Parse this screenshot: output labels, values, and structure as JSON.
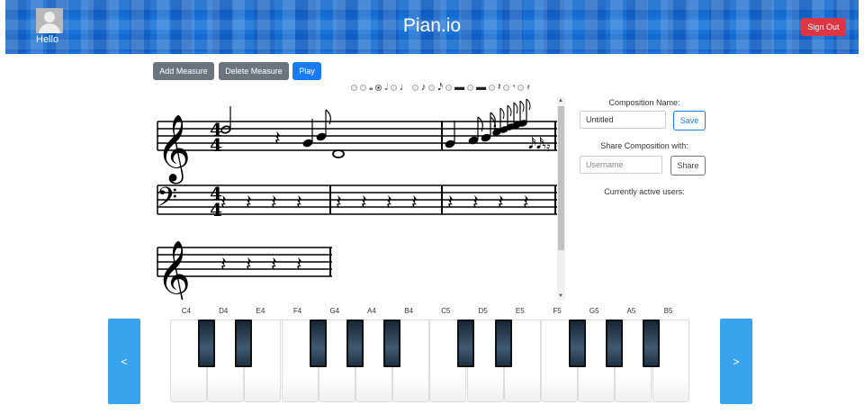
{
  "header": {
    "title": "Pian.io",
    "greeting": "Hello",
    "sign_out": "Sign Out",
    "avatar_icon": "user-avatar-icon"
  },
  "toolbar": {
    "add_measure": "Add Measure",
    "delete_measure": "Delete Measure",
    "play": "Play"
  },
  "note_selector": {
    "options": [
      {
        "icon": "none",
        "selected": false
      },
      {
        "icon": "whole-note-icon",
        "glyph": "𝅝",
        "selected": false
      },
      {
        "icon": "half-note-icon",
        "glyph": "𝅗𝅥",
        "selected": true
      },
      {
        "icon": "quarter-note-icon",
        "glyph": "♩",
        "selected": false
      },
      {
        "icon": "eighth-note-icon",
        "glyph": "♪",
        "selected": false
      },
      {
        "icon": "sixteenth-note-icon",
        "glyph": "𝅘𝅥𝅯",
        "selected": false
      },
      {
        "icon": "whole-rest-icon",
        "glyph": "▬",
        "selected": false
      },
      {
        "icon": "half-rest-icon",
        "glyph": "▬",
        "selected": false
      },
      {
        "icon": "quarter-rest-icon",
        "glyph": "𝄽",
        "selected": false
      },
      {
        "icon": "eighth-rest-icon",
        "glyph": "𝄾",
        "selected": false
      },
      {
        "icon": "sixteenth-rest-icon",
        "glyph": "𝄿",
        "selected": false
      }
    ]
  },
  "score": {
    "time_signature": {
      "top": "4",
      "bottom": "4"
    }
  },
  "composition": {
    "name_label": "Composition Name:",
    "name_value": "Untitled",
    "save": "Save",
    "share_label": "Share Composition with:",
    "share_placeholder": "Username",
    "share": "Share",
    "active_users_label": "Currently active users:"
  },
  "keyboard": {
    "prev": "<",
    "next": ">",
    "white_keys": [
      "C4",
      "D4",
      "E4",
      "F4",
      "G4",
      "A4",
      "B4",
      "C5",
      "D5",
      "E5",
      "F5",
      "G5",
      "A5",
      "B5"
    ]
  }
}
